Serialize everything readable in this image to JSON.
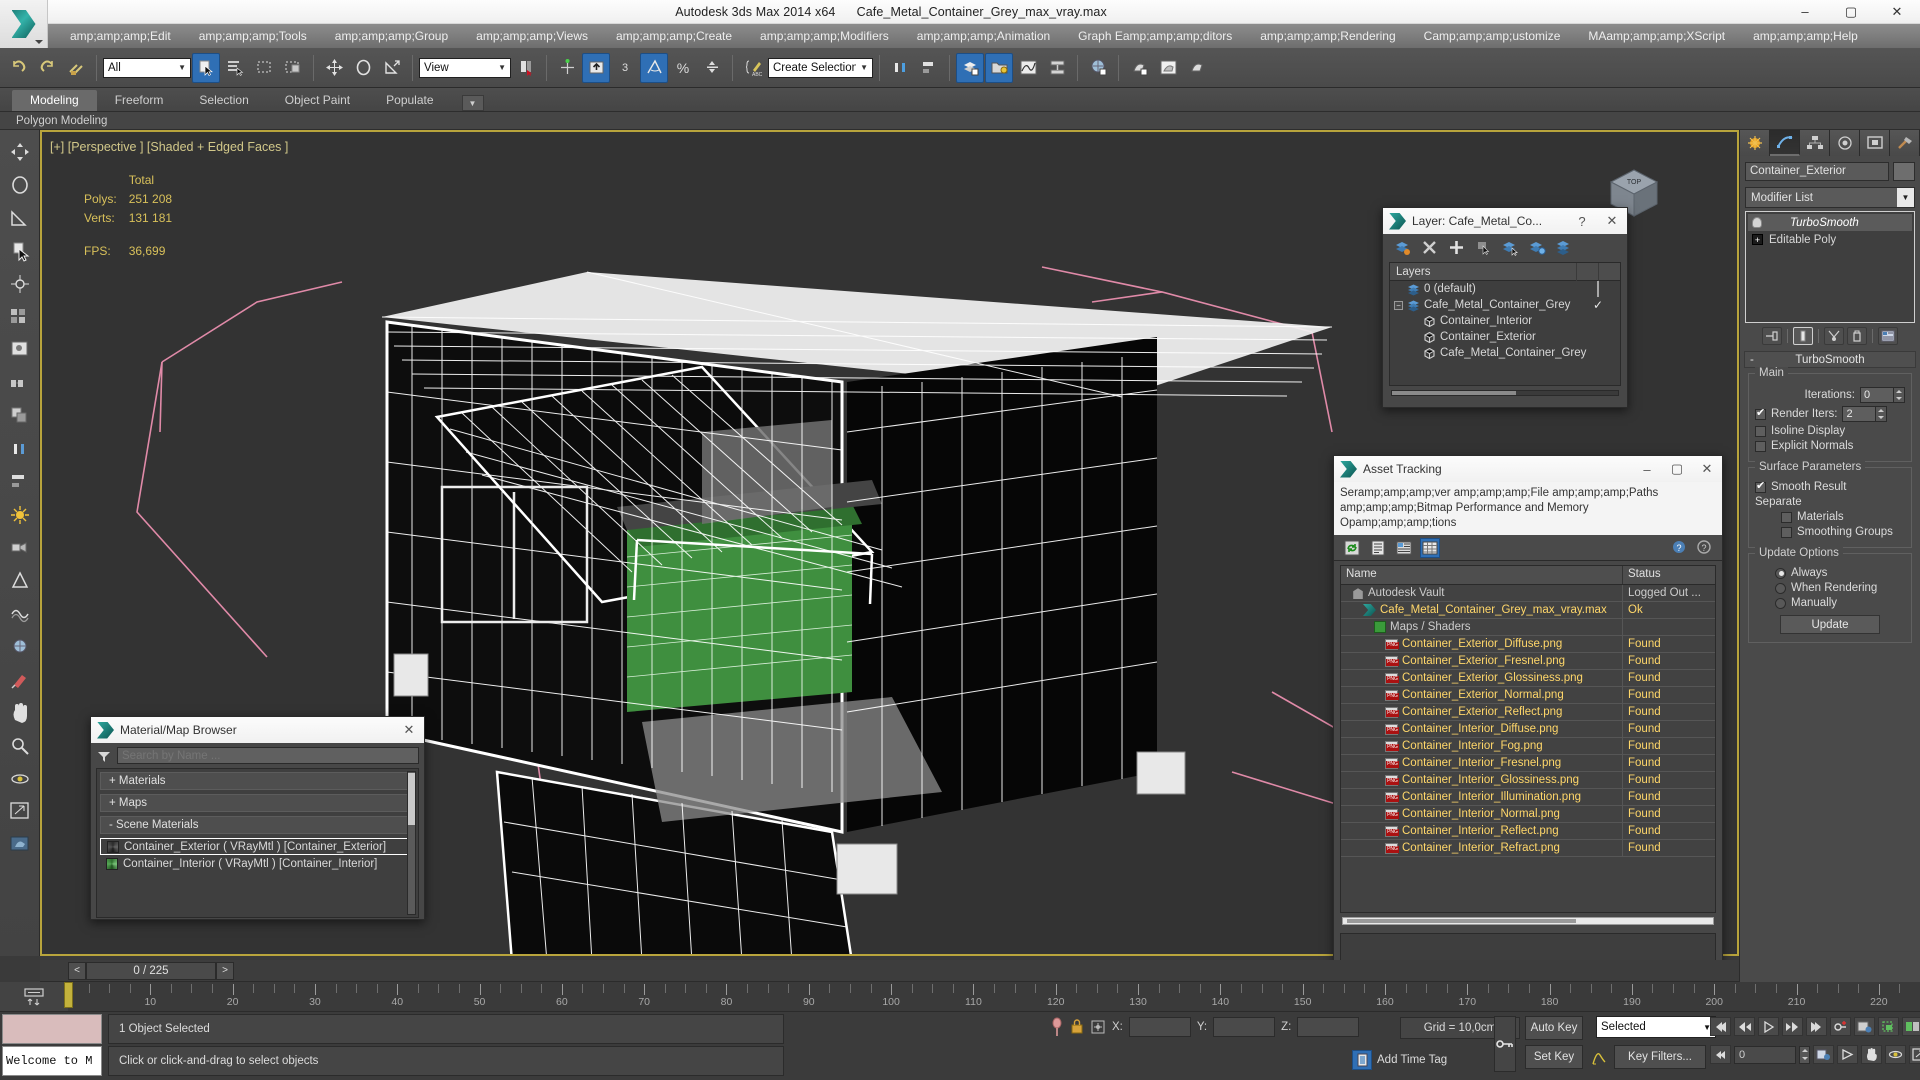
{
  "window": {
    "title_app": "Autodesk 3ds Max  2014 x64",
    "title_file": "Cafe_Metal_Container_Grey_max_vray.max",
    "minimize": "–",
    "maximize": "▢",
    "close": "✕"
  },
  "menu": {
    "items": [
      "amp;amp;amp;Edit",
      "amp;amp;amp;Tools",
      "amp;amp;amp;Group",
      "amp;amp;amp;Views",
      "amp;amp;amp;Create",
      "amp;amp;amp;Modifiers",
      "amp;amp;amp;Animation",
      "Graph Eamp;amp;amp;ditors",
      "amp;amp;amp;Rendering",
      "Camp;amp;amp;ustomize",
      "MAamp;amp;amp;XScript",
      "amp;amp;amp;Help"
    ]
  },
  "toolbar": {
    "selection_filter": "All",
    "reference_coordinate": "View",
    "named_selection_set": "Create Selection Se",
    "snap_toggle_label": "3",
    "icons": [
      "undo-icon",
      "redo-icon",
      "select-link-icon",
      "unlink-icon",
      "bind-spacewarp-icon",
      "select-object-icon",
      "select-by-name-icon",
      "select-region-icon",
      "window-crossing-icon",
      "select-move-icon",
      "select-rotate-icon",
      "select-scale-icon",
      "use-center-icon",
      "select-manipulate-icon",
      "snap-toggle-icon",
      "angle-snap-icon",
      "percent-snap-icon",
      "spinner-snap-icon",
      "edit-named-selection-icon",
      "mirror-icon",
      "align-icon",
      "layer-manager-icon",
      "scene-explorer-icon",
      "curve-editor-icon",
      "schematic-view-icon",
      "material-editor-icon",
      "render-setup-icon",
      "rendered-frame-icon",
      "render-production-icon"
    ]
  },
  "ribbon": {
    "tabs": [
      "Modeling",
      "Freeform",
      "Selection",
      "Object Paint",
      "Populate"
    ],
    "active_tab": "Modeling",
    "panel_label": "Polygon Modeling"
  },
  "left_toolbar": {
    "icons": [
      "move-tool-icon",
      "rotate-tool-icon",
      "scale-tool-icon",
      "select-tool-icon",
      "pivot-icon",
      "array-icon",
      "snapshot-icon",
      "spacing-icon",
      "clone-icon",
      "mirror-tool-icon",
      "align-tool-icon",
      "light-icon",
      "camera-icon",
      "helper-icon",
      "space-warp-icon",
      "material-icon",
      "paint-icon",
      "hand-icon",
      "zoom-icon",
      "orbit-icon",
      "maximize-icon",
      "preview-icon"
    ]
  },
  "viewport": {
    "label": "[+] [Perspective ] [Shaded + Edged Faces ]",
    "stats": {
      "total_header": "Total",
      "polys_label": "Polys:",
      "polys_value": "251 208",
      "verts_label": "Verts:",
      "verts_value": "131 181",
      "fps_label": "FPS:",
      "fps_value": "36,699"
    },
    "viewcube_label": "TOP"
  },
  "layer_dialog": {
    "title": "Layer: Cafe_Metal_Co...",
    "help_btn": "?",
    "close_btn": "✕",
    "tool_icons": [
      "create-new-layer-icon",
      "delete-layer-icon",
      "add-selection-icon",
      "select-objects-in-layer-icon",
      "select-highlighted-icon",
      "highlight-selected-icon",
      "layer-properties-icon"
    ],
    "column_header": "Layers",
    "rows": [
      {
        "name": "0 (default)",
        "indent": 0,
        "icon": "layer-icon",
        "mark": "box",
        "expander": false
      },
      {
        "name": "Cafe_Metal_Container_Grey",
        "indent": 0,
        "icon": "layer-icon",
        "mark": "check",
        "expander": true
      },
      {
        "name": "Container_Interior",
        "indent": 1,
        "icon": "object-icon",
        "mark": "",
        "expander": false
      },
      {
        "name": "Container_Exterior",
        "indent": 1,
        "icon": "object-icon",
        "mark": "",
        "expander": false
      },
      {
        "name": "Cafe_Metal_Container_Grey",
        "indent": 1,
        "icon": "object-icon",
        "mark": "",
        "expander": false
      }
    ]
  },
  "asset_dialog": {
    "title": "Asset Tracking",
    "minimize": "–",
    "maximize": "▢",
    "close": "✕",
    "menu_lines": [
      "Seramp;amp;amp;ver    amp;amp;amp;File    amp;amp;amp;Paths",
      "amp;amp;amp;Bitmap Performance and Memory",
      "Opamp;amp;amp;tions"
    ],
    "tool_icons": [
      "refresh-icon",
      "list-view-icon",
      "details-view-icon",
      "grid-view-icon"
    ],
    "help_icons": [
      "help-add-icon",
      "help-icon"
    ],
    "columns": [
      "Name",
      "Status"
    ],
    "rows": [
      {
        "name": "Autodesk Vault",
        "status": "Logged Out ...",
        "icon": "vault-icon",
        "indent": 1,
        "highlight": false
      },
      {
        "name": "Cafe_Metal_Container_Grey_max_vray.max",
        "status": "Ok",
        "icon": "max-icon",
        "indent": 2,
        "highlight": true
      },
      {
        "name": "Maps / Shaders",
        "status": "",
        "icon": "map-icon",
        "indent": 3,
        "highlight": false
      },
      {
        "name": "Container_Exterior_Diffuse.png",
        "status": "Found",
        "icon": "png-icon",
        "indent": 4,
        "highlight": true
      },
      {
        "name": "Container_Exterior_Fresnel.png",
        "status": "Found",
        "icon": "png-icon",
        "indent": 4,
        "highlight": true
      },
      {
        "name": "Container_Exterior_Glossiness.png",
        "status": "Found",
        "icon": "png-icon",
        "indent": 4,
        "highlight": true
      },
      {
        "name": "Container_Exterior_Normal.png",
        "status": "Found",
        "icon": "png-icon",
        "indent": 4,
        "highlight": true
      },
      {
        "name": "Container_Exterior_Reflect.png",
        "status": "Found",
        "icon": "png-icon",
        "indent": 4,
        "highlight": true
      },
      {
        "name": "Container_Interior_Diffuse.png",
        "status": "Found",
        "icon": "png-icon",
        "indent": 4,
        "highlight": true
      },
      {
        "name": "Container_Interior_Fog.png",
        "status": "Found",
        "icon": "png-icon",
        "indent": 4,
        "highlight": true
      },
      {
        "name": "Container_Interior_Fresnel.png",
        "status": "Found",
        "icon": "png-icon",
        "indent": 4,
        "highlight": true
      },
      {
        "name": "Container_Interior_Glossiness.png",
        "status": "Found",
        "icon": "png-icon",
        "indent": 4,
        "highlight": true
      },
      {
        "name": "Container_Interior_Illumination.png",
        "status": "Found",
        "icon": "png-icon",
        "indent": 4,
        "highlight": true
      },
      {
        "name": "Container_Interior_Normal.png",
        "status": "Found",
        "icon": "png-icon",
        "indent": 4,
        "highlight": true
      },
      {
        "name": "Container_Interior_Reflect.png",
        "status": "Found",
        "icon": "png-icon",
        "indent": 4,
        "highlight": true
      },
      {
        "name": "Container_Interior_Refract.png",
        "status": "Found",
        "icon": "png-icon",
        "indent": 4,
        "highlight": true
      }
    ]
  },
  "material_browser": {
    "title": "Material/Map Browser",
    "close_btn": "✕",
    "search_placeholder": "Search by Name ...",
    "search_value": "",
    "groups": [
      {
        "label": "+ Materials"
      },
      {
        "label": "+ Maps"
      },
      {
        "label": "-  Scene Materials"
      }
    ],
    "scene_materials": [
      {
        "label": "Container_Exterior  ( VRayMtl )  [Container_Exterior]",
        "selected": true
      },
      {
        "label": "Container_Interior  ( VRayMtl )  [Container_Interior]",
        "selected": false
      }
    ]
  },
  "command_panel": {
    "tabs": [
      "create-tab-icon",
      "modify-tab-icon",
      "hierarchy-tab-icon",
      "motion-tab-icon",
      "display-tab-icon",
      "utilities-tab-icon"
    ],
    "active_tab_index": 1,
    "object_name": "Container_Exterior",
    "modifier_list_label": "Modifier List",
    "stack": [
      {
        "label": "TurboSmooth",
        "selected": true,
        "icon": "light-bulb-icon"
      },
      {
        "label": "Editable Poly",
        "selected": false,
        "icon": "expand-plus-icon"
      }
    ],
    "stack_buttons": [
      "pin-stack-icon",
      "show-end-result-icon",
      "make-unique-icon",
      "remove-modifier-icon",
      "configure-sets-icon"
    ],
    "rollout": {
      "title": "TurboSmooth",
      "collapse": "-",
      "groups": [
        {
          "title": "Main",
          "fields": [
            {
              "type": "spinner",
              "label": "Iterations:",
              "value": "0"
            },
            {
              "type": "check_spinner",
              "label": "Render Iters:",
              "value": "2",
              "checked": true
            },
            {
              "type": "checkbox",
              "label": "Isoline Display",
              "checked": false
            },
            {
              "type": "checkbox",
              "label": "Explicit Normals",
              "checked": false
            }
          ]
        },
        {
          "title": "Surface Parameters",
          "fields": [
            {
              "type": "checkbox",
              "label": "Smooth Result",
              "checked": true
            },
            {
              "type": "text",
              "label": "Separate"
            },
            {
              "type": "checkbox",
              "label": "Materials",
              "checked": false,
              "indent": true
            },
            {
              "type": "checkbox",
              "label": "Smoothing Groups",
              "checked": false,
              "indent": true
            }
          ]
        },
        {
          "title": "Update Options",
          "fields": [
            {
              "type": "radio",
              "label": "Always",
              "checked": true
            },
            {
              "type": "radio",
              "label": "When Rendering",
              "checked": false
            },
            {
              "type": "radio",
              "label": "Manually",
              "checked": false
            },
            {
              "type": "button",
              "label": "Update"
            }
          ]
        }
      ]
    }
  },
  "timeline": {
    "prev_btn": "<",
    "frame_display": "0 / 225",
    "next_btn": ">",
    "ruler_labels": [
      "10",
      "20",
      "30",
      "40",
      "50",
      "60",
      "70",
      "80",
      "90",
      "100",
      "110",
      "120",
      "130",
      "140",
      "150",
      "160",
      "170",
      "180",
      "190",
      "200",
      "210",
      "220"
    ],
    "current_frame": 0,
    "max_frame": 225
  },
  "status_bar": {
    "welcome_text": "Welcome to M",
    "selection_status": "1 Object Selected",
    "prompt": "Click or click-and-drag to select objects",
    "coord_x_label": "X:",
    "coord_y_label": "Y:",
    "coord_z_label": "Z:",
    "coord_x_value": "",
    "coord_y_value": "",
    "coord_z_value": "",
    "grid_label": "Grid = 10,0cm",
    "add_time_tag": "Add Time Tag",
    "auto_key": "Auto Key",
    "set_key": "Set Key",
    "key_mode_selected": "Selected",
    "key_filters": "Key Filters...",
    "key_frame_value": "0"
  },
  "colors": {
    "accent_blue": "#2f6fb5",
    "viewport_border": "#b8a43c",
    "viewport_bg": "#333333",
    "stats_text": "#d8c05a",
    "panel_bg": "#4a4a4a",
    "menu_bg": "#6e6e6e",
    "highlight_yellow": "#ffd76a"
  }
}
